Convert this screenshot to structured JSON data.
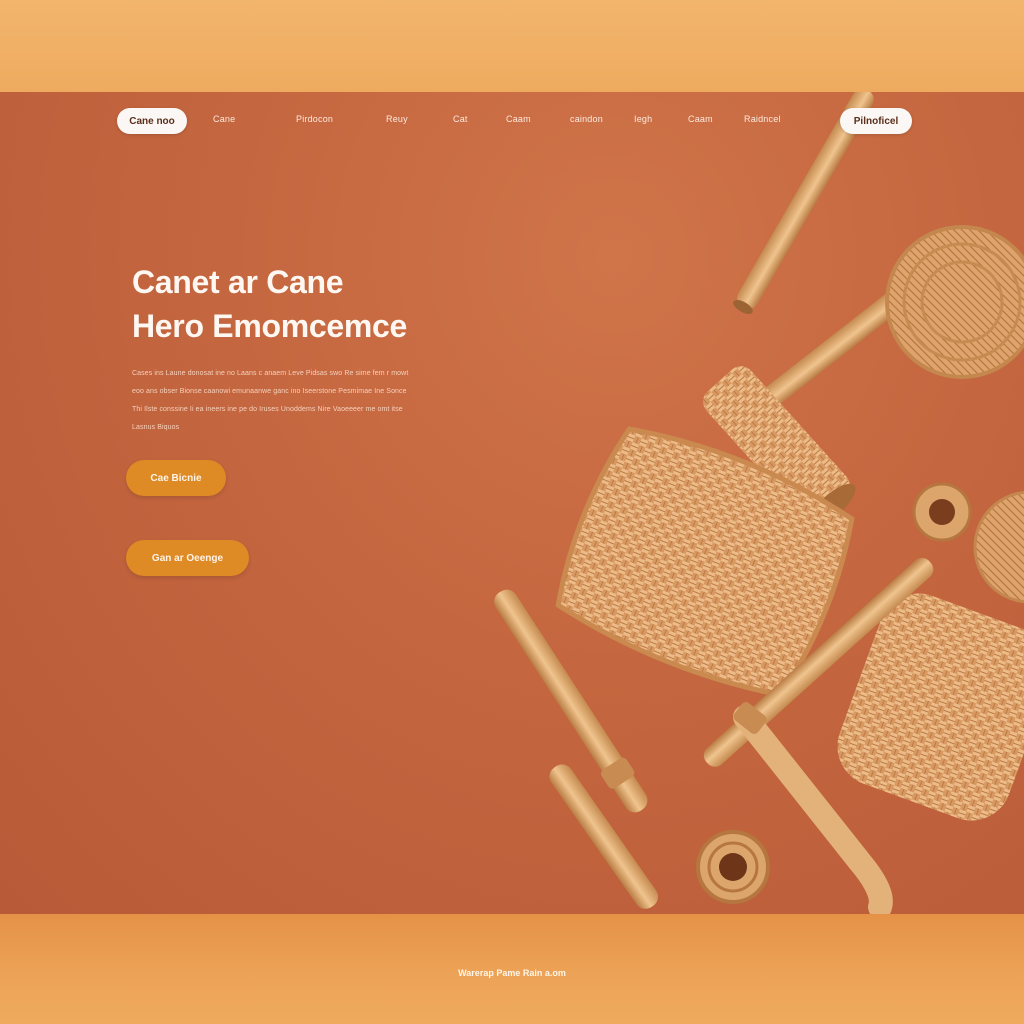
{
  "nav": {
    "brand_pill": "Cane noo",
    "links": [
      "Cane",
      "Pirdocon",
      "Reuy",
      "Cat",
      "Caam",
      "caindon",
      "Iegh",
      "Caam",
      "Raidncel"
    ],
    "cta_pill": "Pilnoficel"
  },
  "hero": {
    "headline_1": "Canet ar Cane",
    "headline_2": "Hero Emomcemce",
    "body_lines": [
      "Cases ins Laune donosat ine no Laans c anaem Leve Pidsas swo Re sime fem r mowt",
      "eoo ans obser Bionse caanowi emunaanwe ganc ino Iseerstone Pesmimae Ine Sonce",
      "Thi Ilste conssine Ii ea ineers ine pe do Iruses Unoddems Nire Vaoeeeer me omt itse",
      "Lasnus Biquos"
    ],
    "cta_primary": "Cae Bicnie",
    "cta_secondary": "Gan ar Oeenge"
  },
  "footer": {
    "text": "Warerap Pame Rain a.om"
  },
  "colors": {
    "hero_bg": "#c4663f",
    "accent_orange": "#de8a25",
    "outer_band": "#eeab60",
    "bamboo": "#dca56c",
    "rattan": "#e2a974"
  }
}
